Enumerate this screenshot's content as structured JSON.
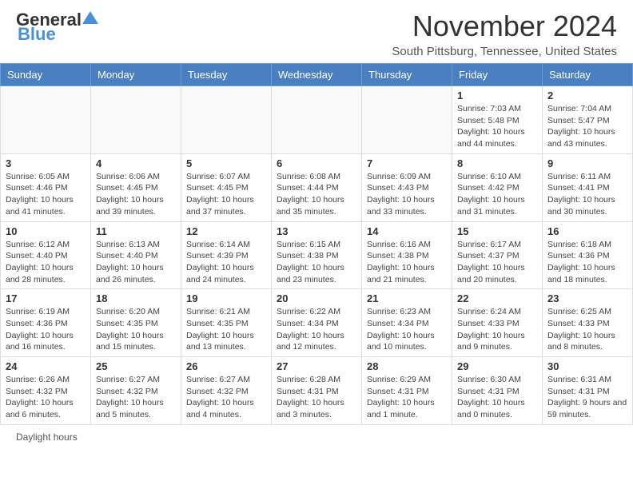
{
  "header": {
    "logo_general": "General",
    "logo_blue": "Blue",
    "month_title": "November 2024",
    "location": "South Pittsburg, Tennessee, United States"
  },
  "days_of_week": [
    "Sunday",
    "Monday",
    "Tuesday",
    "Wednesday",
    "Thursday",
    "Friday",
    "Saturday"
  ],
  "weeks": [
    [
      {
        "day": "",
        "info": ""
      },
      {
        "day": "",
        "info": ""
      },
      {
        "day": "",
        "info": ""
      },
      {
        "day": "",
        "info": ""
      },
      {
        "day": "",
        "info": ""
      },
      {
        "day": "1",
        "info": "Sunrise: 7:03 AM\nSunset: 5:48 PM\nDaylight: 10 hours and 44 minutes."
      },
      {
        "day": "2",
        "info": "Sunrise: 7:04 AM\nSunset: 5:47 PM\nDaylight: 10 hours and 43 minutes."
      }
    ],
    [
      {
        "day": "3",
        "info": "Sunrise: 6:05 AM\nSunset: 4:46 PM\nDaylight: 10 hours and 41 minutes."
      },
      {
        "day": "4",
        "info": "Sunrise: 6:06 AM\nSunset: 4:45 PM\nDaylight: 10 hours and 39 minutes."
      },
      {
        "day": "5",
        "info": "Sunrise: 6:07 AM\nSunset: 4:45 PM\nDaylight: 10 hours and 37 minutes."
      },
      {
        "day": "6",
        "info": "Sunrise: 6:08 AM\nSunset: 4:44 PM\nDaylight: 10 hours and 35 minutes."
      },
      {
        "day": "7",
        "info": "Sunrise: 6:09 AM\nSunset: 4:43 PM\nDaylight: 10 hours and 33 minutes."
      },
      {
        "day": "8",
        "info": "Sunrise: 6:10 AM\nSunset: 4:42 PM\nDaylight: 10 hours and 31 minutes."
      },
      {
        "day": "9",
        "info": "Sunrise: 6:11 AM\nSunset: 4:41 PM\nDaylight: 10 hours and 30 minutes."
      }
    ],
    [
      {
        "day": "10",
        "info": "Sunrise: 6:12 AM\nSunset: 4:40 PM\nDaylight: 10 hours and 28 minutes."
      },
      {
        "day": "11",
        "info": "Sunrise: 6:13 AM\nSunset: 4:40 PM\nDaylight: 10 hours and 26 minutes."
      },
      {
        "day": "12",
        "info": "Sunrise: 6:14 AM\nSunset: 4:39 PM\nDaylight: 10 hours and 24 minutes."
      },
      {
        "day": "13",
        "info": "Sunrise: 6:15 AM\nSunset: 4:38 PM\nDaylight: 10 hours and 23 minutes."
      },
      {
        "day": "14",
        "info": "Sunrise: 6:16 AM\nSunset: 4:38 PM\nDaylight: 10 hours and 21 minutes."
      },
      {
        "day": "15",
        "info": "Sunrise: 6:17 AM\nSunset: 4:37 PM\nDaylight: 10 hours and 20 minutes."
      },
      {
        "day": "16",
        "info": "Sunrise: 6:18 AM\nSunset: 4:36 PM\nDaylight: 10 hours and 18 minutes."
      }
    ],
    [
      {
        "day": "17",
        "info": "Sunrise: 6:19 AM\nSunset: 4:36 PM\nDaylight: 10 hours and 16 minutes."
      },
      {
        "day": "18",
        "info": "Sunrise: 6:20 AM\nSunset: 4:35 PM\nDaylight: 10 hours and 15 minutes."
      },
      {
        "day": "19",
        "info": "Sunrise: 6:21 AM\nSunset: 4:35 PM\nDaylight: 10 hours and 13 minutes."
      },
      {
        "day": "20",
        "info": "Sunrise: 6:22 AM\nSunset: 4:34 PM\nDaylight: 10 hours and 12 minutes."
      },
      {
        "day": "21",
        "info": "Sunrise: 6:23 AM\nSunset: 4:34 PM\nDaylight: 10 hours and 10 minutes."
      },
      {
        "day": "22",
        "info": "Sunrise: 6:24 AM\nSunset: 4:33 PM\nDaylight: 10 hours and 9 minutes."
      },
      {
        "day": "23",
        "info": "Sunrise: 6:25 AM\nSunset: 4:33 PM\nDaylight: 10 hours and 8 minutes."
      }
    ],
    [
      {
        "day": "24",
        "info": "Sunrise: 6:26 AM\nSunset: 4:32 PM\nDaylight: 10 hours and 6 minutes."
      },
      {
        "day": "25",
        "info": "Sunrise: 6:27 AM\nSunset: 4:32 PM\nDaylight: 10 hours and 5 minutes."
      },
      {
        "day": "26",
        "info": "Sunrise: 6:27 AM\nSunset: 4:32 PM\nDaylight: 10 hours and 4 minutes."
      },
      {
        "day": "27",
        "info": "Sunrise: 6:28 AM\nSunset: 4:31 PM\nDaylight: 10 hours and 3 minutes."
      },
      {
        "day": "28",
        "info": "Sunrise: 6:29 AM\nSunset: 4:31 PM\nDaylight: 10 hours and 1 minute."
      },
      {
        "day": "29",
        "info": "Sunrise: 6:30 AM\nSunset: 4:31 PM\nDaylight: 10 hours and 0 minutes."
      },
      {
        "day": "30",
        "info": "Sunrise: 6:31 AM\nSunset: 4:31 PM\nDaylight: 9 hours and 59 minutes."
      }
    ]
  ],
  "footer": {
    "daylight_label": "Daylight hours"
  }
}
